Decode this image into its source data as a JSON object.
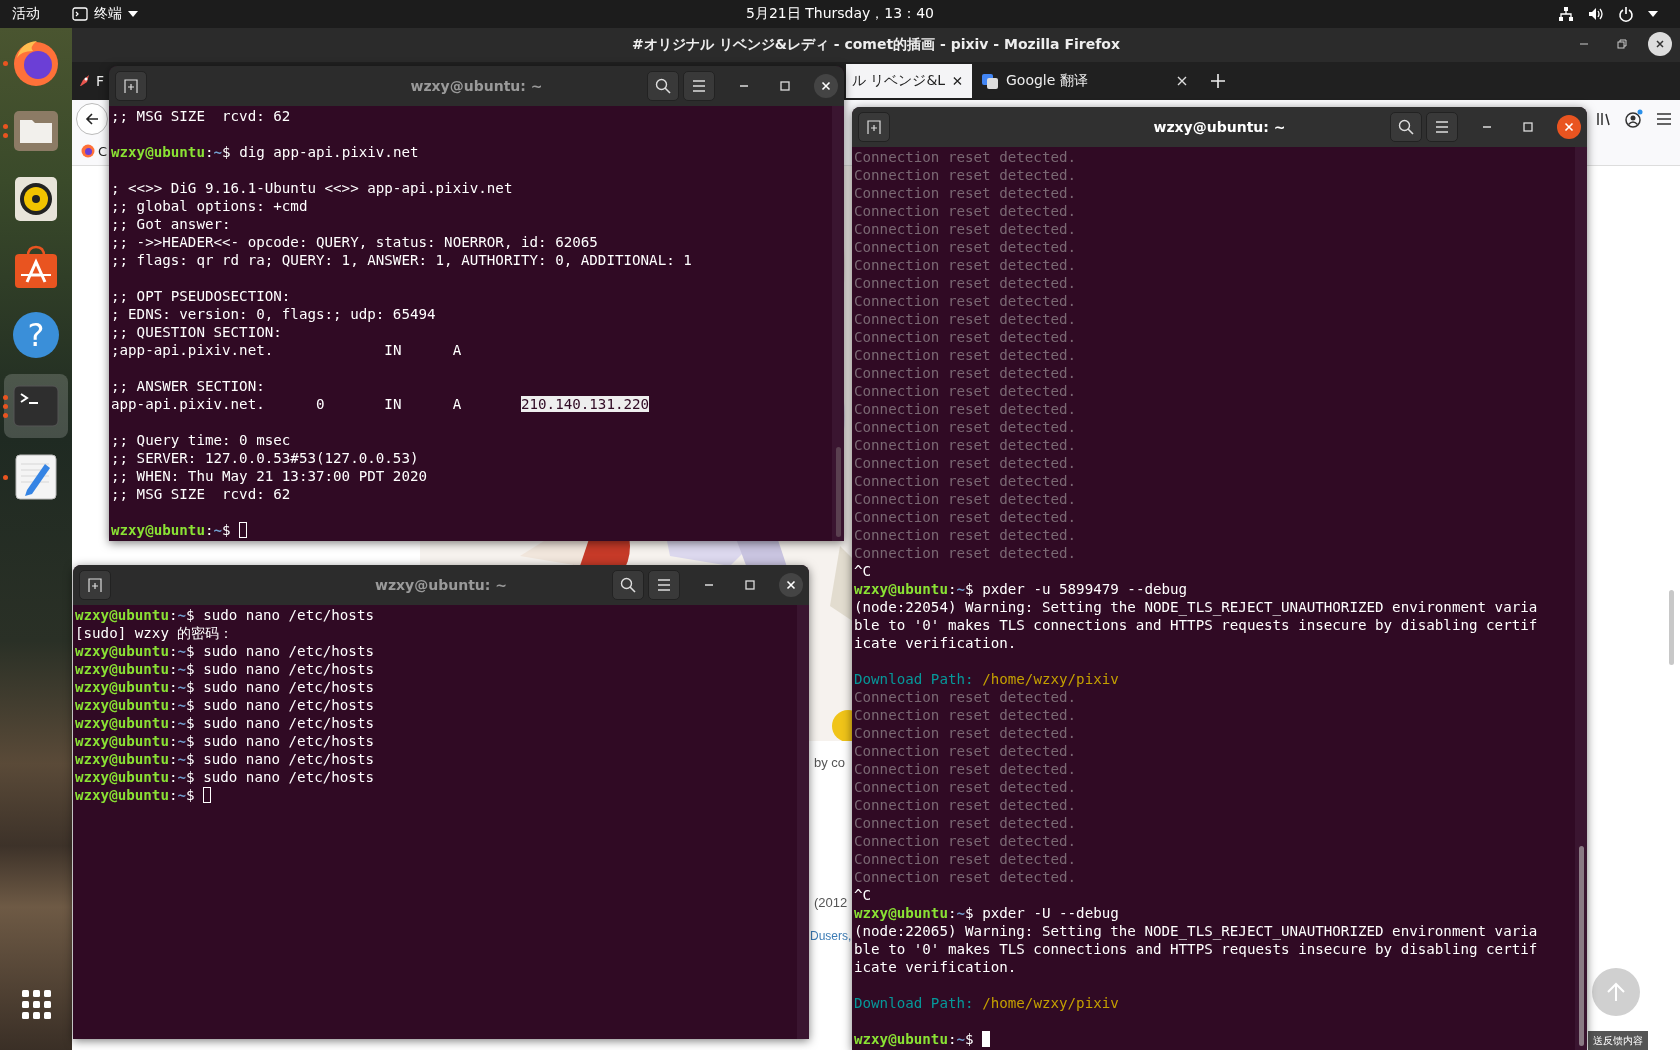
{
  "top_bar": {
    "activities": "活动",
    "app_menu": "终端",
    "clock": "5月21日 Thursday，13：40"
  },
  "dock": {
    "items": [
      {
        "kind": "firefox",
        "windows": [
          {
            "kind": "window"
          }
        ],
        "focused": false
      },
      {
        "kind": "files",
        "windows": [
          {
            "kind": "window"
          },
          {
            "kind": "window"
          }
        ],
        "focused": false
      },
      {
        "kind": "rhythmbox",
        "focused": false
      },
      {
        "kind": "software",
        "focused": false
      },
      {
        "kind": "help",
        "focused": false,
        "glyph": "?"
      },
      {
        "kind": "terminal",
        "windows": [
          {
            "kind": "window"
          },
          {
            "kind": "window"
          },
          {
            "kind": "window"
          }
        ],
        "focused": true
      },
      {
        "kind": "editor",
        "windows": [
          {
            "kind": "window"
          }
        ],
        "focused": false
      }
    ]
  },
  "browser": {
    "title": "#オリジナル リベンジ&レディ - comet的插画 - pixiv - Mozilla Firefox",
    "tabs": [
      {
        "label": "F",
        "selected": false
      },
      {
        "label": "ル リベンジ&L",
        "selected": true
      },
      {
        "label": "Google 翻译",
        "selected": false
      }
    ],
    "bookmark": "C",
    "page_texts": [
      {
        "kind": "caption",
        "text": "by co"
      },
      {
        "kind": "caption",
        "text": "(2012"
      },
      {
        "kind": "link",
        "text": "Dusers,"
      }
    ],
    "feedback": "送反馈内容"
  },
  "terminals": [
    {
      "title": "wzxy@ubuntu: ~",
      "active": false,
      "scrollback": true,
      "lines": [
        {
          "kind": "out",
          "text": ";; MSG SIZE  rcvd: 62"
        },
        {
          "kind": "blank"
        },
        {
          "kind": "prompt",
          "user": "wzxy@ubuntu",
          "sep": ":",
          "dir": "~",
          "command": "$ dig app-api.pixiv.net",
          "cursor": false
        },
        {
          "kind": "blank"
        },
        {
          "kind": "out",
          "text": "; <<>> DiG 9.16.1-Ubuntu <<>> app-api.pixiv.net"
        },
        {
          "kind": "out",
          "text": ";; global options: +cmd"
        },
        {
          "kind": "out",
          "text": ";; Got answer:"
        },
        {
          "kind": "out",
          "text": ";; ->>HEADER<<- opcode: QUERY, status: NOERROR, id: 62065"
        },
        {
          "kind": "out",
          "text": ";; flags: qr rd ra; QUERY: 1, ANSWER: 1, AUTHORITY: 0, ADDITIONAL: 1"
        },
        {
          "kind": "blank"
        },
        {
          "kind": "out",
          "text": ";; OPT PSEUDOSECTION:"
        },
        {
          "kind": "out",
          "text": "; EDNS: version: 0, flags:; udp: 65494"
        },
        {
          "kind": "out",
          "text": ";; QUESTION SECTION:"
        },
        {
          "kind": "out",
          "text": ";app-api.pixiv.net.\t\tIN\tA"
        },
        {
          "kind": "blank"
        },
        {
          "kind": "out",
          "text": ";; ANSWER SECTION:"
        },
        {
          "kind": "answer",
          "text": "app-api.pixiv.net.\t0\tIN\tA\t",
          "highlight": "210.140.131.220"
        },
        {
          "kind": "blank"
        },
        {
          "kind": "out",
          "text": ";; Query time: 0 msec"
        },
        {
          "kind": "out",
          "text": ";; SERVER: 127.0.0.53#53(127.0.0.53)"
        },
        {
          "kind": "out",
          "text": ";; WHEN: Thu May 21 13:37:00 PDT 2020"
        },
        {
          "kind": "out",
          "text": ";; MSG SIZE  rcvd: 62"
        },
        {
          "kind": "blank"
        },
        {
          "kind": "prompt",
          "user": "wzxy@ubuntu",
          "sep": ":",
          "dir": "~",
          "command": "$ ",
          "cursor": true
        }
      ]
    },
    {
      "title": "wzxy@ubuntu: ~",
      "active": false,
      "scrollback": false,
      "lines": [
        {
          "kind": "prompt",
          "user": "wzxy@ubuntu",
          "sep": ":",
          "dir": "~",
          "command": "$ sudo nano /etc/hosts",
          "cursor": false
        },
        {
          "kind": "out",
          "text": "[sudo] wzxy 的密码："
        },
        {
          "kind": "prompt",
          "user": "wzxy@ubuntu",
          "sep": ":",
          "dir": "~",
          "command": "$ sudo nano /etc/hosts",
          "cursor": false
        },
        {
          "kind": "prompt",
          "user": "wzxy@ubuntu",
          "sep": ":",
          "dir": "~",
          "command": "$ sudo nano /etc/hosts",
          "cursor": false
        },
        {
          "kind": "prompt",
          "user": "wzxy@ubuntu",
          "sep": ":",
          "dir": "~",
          "command": "$ sudo nano /etc/hosts",
          "cursor": false
        },
        {
          "kind": "prompt",
          "user": "wzxy@ubuntu",
          "sep": ":",
          "dir": "~",
          "command": "$ sudo nano /etc/hosts",
          "cursor": false
        },
        {
          "kind": "prompt",
          "user": "wzxy@ubuntu",
          "sep": ":",
          "dir": "~",
          "command": "$ sudo nano /etc/hosts",
          "cursor": false
        },
        {
          "kind": "prompt",
          "user": "wzxy@ubuntu",
          "sep": ":",
          "dir": "~",
          "command": "$ sudo nano /etc/hosts",
          "cursor": false
        },
        {
          "kind": "prompt",
          "user": "wzxy@ubuntu",
          "sep": ":",
          "dir": "~",
          "command": "$ sudo nano /etc/hosts",
          "cursor": false
        },
        {
          "kind": "prompt",
          "user": "wzxy@ubuntu",
          "sep": ":",
          "dir": "~",
          "command": "$ sudo nano /etc/hosts",
          "cursor": false
        },
        {
          "kind": "prompt",
          "user": "wzxy@ubuntu",
          "sep": ":",
          "dir": "~",
          "command": "$ ",
          "cursor": true
        }
      ]
    },
    {
      "title": "wzxy@ubuntu: ~",
      "active": true,
      "scrollback": true,
      "lines": [
        {
          "kind": "dim",
          "text": "Connection reset detected."
        },
        {
          "kind": "dim",
          "text": "Connection reset detected."
        },
        {
          "kind": "dim",
          "text": "Connection reset detected."
        },
        {
          "kind": "dim",
          "text": "Connection reset detected."
        },
        {
          "kind": "dim",
          "text": "Connection reset detected."
        },
        {
          "kind": "dim",
          "text": "Connection reset detected."
        },
        {
          "kind": "dim",
          "text": "Connection reset detected."
        },
        {
          "kind": "dim",
          "text": "Connection reset detected."
        },
        {
          "kind": "dim",
          "text": "Connection reset detected."
        },
        {
          "kind": "dim",
          "text": "Connection reset detected."
        },
        {
          "kind": "dim",
          "text": "Connection reset detected."
        },
        {
          "kind": "dim",
          "text": "Connection reset detected."
        },
        {
          "kind": "dim",
          "text": "Connection reset detected."
        },
        {
          "kind": "dim",
          "text": "Connection reset detected."
        },
        {
          "kind": "dim",
          "text": "Connection reset detected."
        },
        {
          "kind": "dim",
          "text": "Connection reset detected."
        },
        {
          "kind": "dim",
          "text": "Connection reset detected."
        },
        {
          "kind": "dim",
          "text": "Connection reset detected."
        },
        {
          "kind": "dim",
          "text": "Connection reset detected."
        },
        {
          "kind": "dim",
          "text": "Connection reset detected."
        },
        {
          "kind": "dim",
          "text": "Connection reset detected."
        },
        {
          "kind": "dim",
          "text": "Connection reset detected."
        },
        {
          "kind": "dim",
          "text": "Connection reset detected."
        },
        {
          "kind": "out",
          "text": "^C"
        },
        {
          "kind": "prompt",
          "user": "wzxy@ubuntu",
          "sep": ":",
          "dir": "~",
          "command": "$ pxder -u 5899479 --debug",
          "cursor": false
        },
        {
          "kind": "out",
          "text": "(node:22054) Warning: Setting the NODE_TLS_REJECT_UNAUTHORIZED environment varia"
        },
        {
          "kind": "out",
          "text": "ble to '0' makes TLS connections and HTTPS requests insecure by disabling certif"
        },
        {
          "kind": "out",
          "text": "icate verification."
        },
        {
          "kind": "blank"
        },
        {
          "kind": "path",
          "label": "Download Path:",
          "value": "/home/wzxy/pixiv"
        },
        {
          "kind": "dim",
          "text": "Connection reset detected."
        },
        {
          "kind": "dim",
          "text": "Connection reset detected."
        },
        {
          "kind": "dim",
          "text": "Connection reset detected."
        },
        {
          "kind": "dim",
          "text": "Connection reset detected."
        },
        {
          "kind": "dim",
          "text": "Connection reset detected."
        },
        {
          "kind": "dim",
          "text": "Connection reset detected."
        },
        {
          "kind": "dim",
          "text": "Connection reset detected."
        },
        {
          "kind": "dim",
          "text": "Connection reset detected."
        },
        {
          "kind": "dim",
          "text": "Connection reset detected."
        },
        {
          "kind": "dim",
          "text": "Connection reset detected."
        },
        {
          "kind": "dim",
          "text": "Connection reset detected."
        },
        {
          "kind": "out",
          "text": "^C"
        },
        {
          "kind": "prompt",
          "user": "wzxy@ubuntu",
          "sep": ":",
          "dir": "~",
          "command": "$ pxder -U --debug",
          "cursor": false
        },
        {
          "kind": "out",
          "text": "(node:22065) Warning: Setting the NODE_TLS_REJECT_UNAUTHORIZED environment varia"
        },
        {
          "kind": "out",
          "text": "ble to '0' makes TLS connections and HTTPS requests insecure by disabling certif"
        },
        {
          "kind": "out",
          "text": "icate verification."
        },
        {
          "kind": "blank"
        },
        {
          "kind": "path",
          "label": "Download Path:",
          "value": "/home/wzxy/pixiv"
        },
        {
          "kind": "blank"
        },
        {
          "kind": "prompt",
          "user": "wzxy@ubuntu",
          "sep": ":",
          "dir": "~",
          "command": "$ ",
          "cursor": true
        }
      ]
    }
  ]
}
